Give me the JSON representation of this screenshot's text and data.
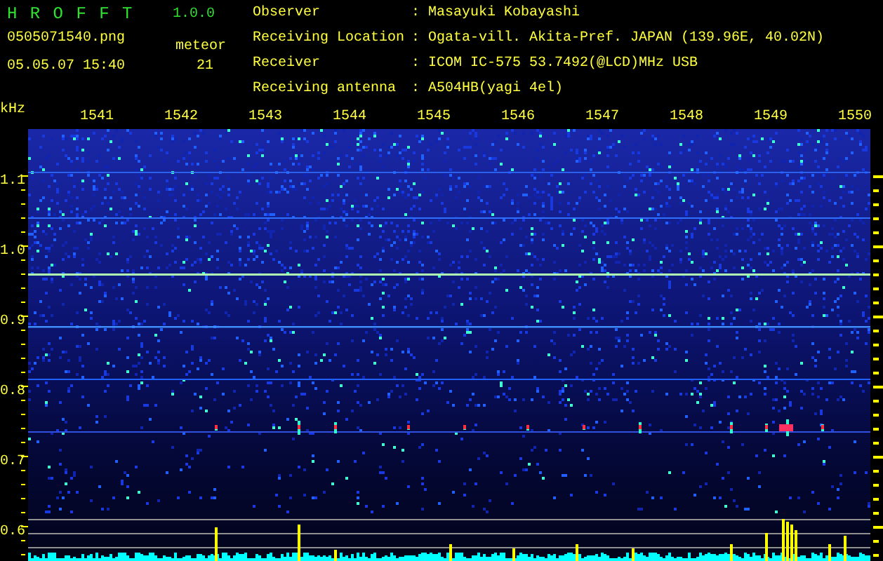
{
  "app": {
    "name": "H R O F F T",
    "version": "1.0.0"
  },
  "file": "0505071540.png",
  "datetime": "05.05.07 15:40",
  "meteor": {
    "label": "meteor",
    "count": "21"
  },
  "info": [
    {
      "label": "Observer",
      "separator": ":",
      "value": "Masayuki Kobayashi"
    },
    {
      "label": "Receiving Location",
      "separator": ":",
      "value": "Ogata-vill. Akita-Pref. JAPAN (139.96E, 40.02N)"
    },
    {
      "label": "Receiver",
      "separator": ":",
      "value": "ICOM IC-575 53.7492(@LCD)MHz USB"
    },
    {
      "label": "Receiving antenna",
      "separator": ":",
      "value": "A504HB(yagi 4el)"
    }
  ],
  "y_axis": {
    "unit": "kHz",
    "labels": [
      "1.1",
      "1.0",
      "0.9",
      "0.8",
      "0.7",
      "0.6"
    ]
  },
  "x_axis": {
    "labels": [
      "1541",
      "1542",
      "1543",
      "1544",
      "1545",
      "1546",
      "1547",
      "1548",
      "1549",
      "1550"
    ]
  }
}
